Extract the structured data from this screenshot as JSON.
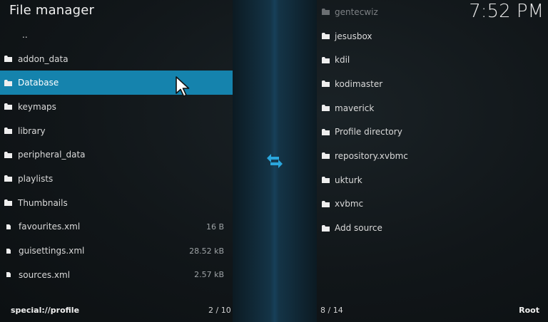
{
  "header": {
    "title": "File manager",
    "clock": "7:52 PM"
  },
  "left_panel": {
    "items": [
      {
        "label": "..",
        "type": "up",
        "size": ""
      },
      {
        "label": "addon_data",
        "type": "folder",
        "size": ""
      },
      {
        "label": "Database",
        "type": "folder",
        "size": "",
        "selected": true
      },
      {
        "label": "keymaps",
        "type": "folder",
        "size": ""
      },
      {
        "label": "library",
        "type": "folder",
        "size": ""
      },
      {
        "label": "peripheral_data",
        "type": "folder",
        "size": ""
      },
      {
        "label": "playlists",
        "type": "folder",
        "size": ""
      },
      {
        "label": "Thumbnails",
        "type": "folder",
        "size": ""
      },
      {
        "label": "favourites.xml",
        "type": "file",
        "size": "16 B"
      },
      {
        "label": "guisettings.xml",
        "type": "file",
        "size": "28.52 kB"
      },
      {
        "label": "sources.xml",
        "type": "file",
        "size": "2.57 kB"
      }
    ],
    "footer_path": "special://profile",
    "footer_count": "2 / 10"
  },
  "right_panel": {
    "items": [
      {
        "label": "gentecwiz",
        "type": "folder",
        "faded": true
      },
      {
        "label": "jesusbox",
        "type": "folder"
      },
      {
        "label": "kdil",
        "type": "folder"
      },
      {
        "label": "kodimaster",
        "type": "folder"
      },
      {
        "label": "maverick",
        "type": "folder"
      },
      {
        "label": "Profile directory",
        "type": "folder"
      },
      {
        "label": "repository.xvbmc",
        "type": "folder"
      },
      {
        "label": "ukturk",
        "type": "folder"
      },
      {
        "label": "xvbmc",
        "type": "folder"
      },
      {
        "label": "Add source",
        "type": "folder"
      }
    ],
    "footer_count": "8 / 14",
    "footer_path": "Root"
  },
  "icons": {
    "folder": "folder-icon",
    "file": "file-icon",
    "up": "parent-directory-icon",
    "swap": "swap-panels-icon",
    "cursor": "mouse-cursor-icon"
  },
  "colors": {
    "selected_row": "#1583ad",
    "swap_icon": "#2aa6dc",
    "center_strip": "#17405a"
  }
}
